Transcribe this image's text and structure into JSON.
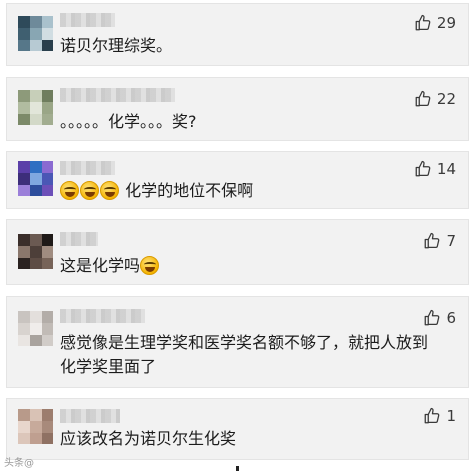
{
  "comments": [
    {
      "text": "诺贝尔理综奖。",
      "likes": "29",
      "avatar_colors": [
        "#2e4a5a",
        "#6e8a9a",
        "#a9c1cc",
        "#3f5f70",
        "#88a6b3",
        "#d0dde2",
        "#567789",
        "#b7cad3",
        "#2a3f4c"
      ]
    },
    {
      "text": "。。。。。化学。。。奖?",
      "likes": "22",
      "avatar_colors": [
        "#8d9a7a",
        "#c7cfb9",
        "#6f7d5e",
        "#b1bca0",
        "#e2e6da",
        "#9aa687",
        "#7c8a69",
        "#d3d9c8",
        "#a2ad90"
      ]
    },
    {
      "text_after_emoji": "化学的地位不保啊",
      "emoji_count": 3,
      "likes": "14",
      "avatar_colors": [
        "#5b3fa8",
        "#2f6fc2",
        "#8a6ad1",
        "#3d2e7a",
        "#7fa8e0",
        "#4a57b5",
        "#9b7fd9",
        "#2d4d9c",
        "#6c4fb8"
      ]
    },
    {
      "text_before_emoji": "这是化学吗",
      "emoji_count": 1,
      "likes": "7",
      "avatar_colors": [
        "#3a2e2a",
        "#6b5a52",
        "#1f1a18",
        "#8a776c",
        "#4d3f39",
        "#a08c80",
        "#2a2220",
        "#5e4d45",
        "#776358"
      ]
    },
    {
      "lines": [
        "感觉像是生理学奖和医学奖名额不够了，就把人放到",
        "化学奖里面了"
      ],
      "likes": "6",
      "avatar_colors": [
        "#c9c4c0",
        "#e3dfdc",
        "#b3ada8",
        "#d8d3cf",
        "#f0edeb",
        "#c1bbb6",
        "#e9e5e2",
        "#a9a39e",
        "#d1ccc8"
      ]
    },
    {
      "text": "应该改名为诺贝尔生化奖",
      "likes": "1",
      "avatar_colors": [
        "#b89a8a",
        "#d9c2b5",
        "#9c7d6e",
        "#e8d6cc",
        "#c7aa9b",
        "#a88a7b",
        "#dcc6ba",
        "#bf9f90",
        "#8f7163"
      ]
    }
  ],
  "watermark": "头条@",
  "icons": {
    "like": "thumbs-up-icon",
    "emoji": "laughing-tears-emoji-icon"
  }
}
